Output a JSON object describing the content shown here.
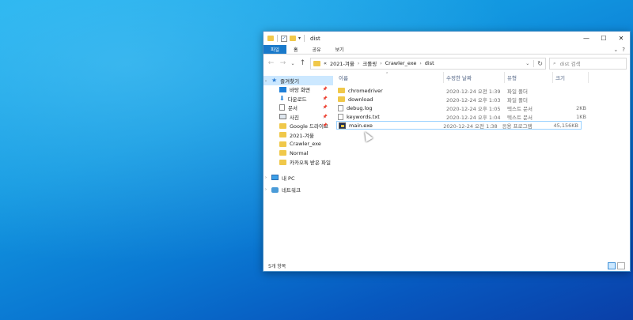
{
  "window": {
    "title": "dist",
    "controls": {
      "minimize": "—",
      "maximize": "☐",
      "close": "✕"
    }
  },
  "ribbon": {
    "tabs": [
      "파일",
      "홈",
      "공유",
      "보기"
    ],
    "expand": "⌄",
    "help": "?"
  },
  "address": {
    "prefix": "«",
    "crumbs": [
      "2021-겨울",
      "크롤링",
      "Crawler_exe",
      "dist"
    ],
    "search_placeholder": "dist 검색"
  },
  "nav": {
    "quick_access": "즐겨찾기",
    "items": [
      {
        "label": "바탕 화면",
        "icon": "desktop-icon",
        "pinned": true
      },
      {
        "label": "다운로드",
        "icon": "download-icon",
        "pinned": true
      },
      {
        "label": "문서",
        "icon": "document-icon",
        "pinned": true
      },
      {
        "label": "사진",
        "icon": "picture-icon",
        "pinned": true
      },
      {
        "label": "Google 드라이브",
        "icon": "folder-icon",
        "pinned": true
      },
      {
        "label": "2021-겨울",
        "icon": "folder-icon",
        "pinned": false
      },
      {
        "label": "Crawler_exe",
        "icon": "folder-icon",
        "pinned": false
      },
      {
        "label": "Normal",
        "icon": "folder-icon",
        "pinned": false
      },
      {
        "label": "카카오톡 받은 파일",
        "icon": "folder-icon",
        "pinned": false
      }
    ],
    "this_pc": "내 PC",
    "network": "네트워크"
  },
  "columns": {
    "name": "이름",
    "date": "수정한 날짜",
    "type": "유형",
    "size": "크기"
  },
  "files": [
    {
      "name": "chromedriver",
      "date": "2020-12-24 오전 1:39",
      "type": "파일 폴더",
      "size": "",
      "icon": "folder-icon"
    },
    {
      "name": "download",
      "date": "2020-12-24 오후 1:03",
      "type": "파일 폴더",
      "size": "",
      "icon": "folder-icon"
    },
    {
      "name": "debug.log",
      "date": "2020-12-24 오후 1:05",
      "type": "텍스트 문서",
      "size": "2KB",
      "icon": "text-file-icon"
    },
    {
      "name": "keywords.txt",
      "date": "2020-12-24 오후 1:04",
      "type": "텍스트 문서",
      "size": "1KB",
      "icon": "text-file-icon"
    },
    {
      "name": "main.exe",
      "date": "2020-12-24 오전 1:38",
      "type": "응용 프로그램",
      "size": "45,156KB",
      "icon": "exe-icon",
      "selected": true
    }
  ],
  "status": {
    "count": "5개 항목"
  },
  "colors": {
    "accent": "#1979ca",
    "selection": "#cce8ff",
    "folder": "#f0c84a"
  }
}
